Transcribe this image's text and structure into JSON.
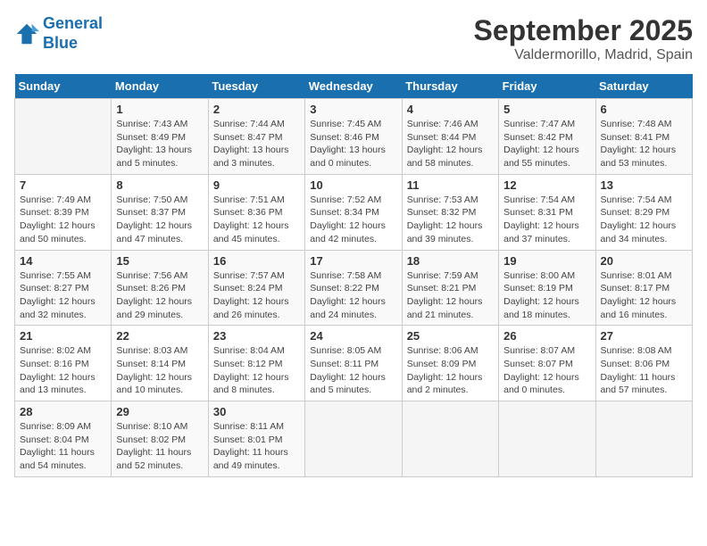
{
  "logo": {
    "line1": "General",
    "line2": "Blue"
  },
  "title": "September 2025",
  "location": "Valdermorillo, Madrid, Spain",
  "weekdays": [
    "Sunday",
    "Monday",
    "Tuesday",
    "Wednesday",
    "Thursday",
    "Friday",
    "Saturday"
  ],
  "weeks": [
    [
      {
        "day": "",
        "info": ""
      },
      {
        "day": "1",
        "info": "Sunrise: 7:43 AM\nSunset: 8:49 PM\nDaylight: 13 hours\nand 5 minutes."
      },
      {
        "day": "2",
        "info": "Sunrise: 7:44 AM\nSunset: 8:47 PM\nDaylight: 13 hours\nand 3 minutes."
      },
      {
        "day": "3",
        "info": "Sunrise: 7:45 AM\nSunset: 8:46 PM\nDaylight: 13 hours\nand 0 minutes."
      },
      {
        "day": "4",
        "info": "Sunrise: 7:46 AM\nSunset: 8:44 PM\nDaylight: 12 hours\nand 58 minutes."
      },
      {
        "day": "5",
        "info": "Sunrise: 7:47 AM\nSunset: 8:42 PM\nDaylight: 12 hours\nand 55 minutes."
      },
      {
        "day": "6",
        "info": "Sunrise: 7:48 AM\nSunset: 8:41 PM\nDaylight: 12 hours\nand 53 minutes."
      }
    ],
    [
      {
        "day": "7",
        "info": "Sunrise: 7:49 AM\nSunset: 8:39 PM\nDaylight: 12 hours\nand 50 minutes."
      },
      {
        "day": "8",
        "info": "Sunrise: 7:50 AM\nSunset: 8:37 PM\nDaylight: 12 hours\nand 47 minutes."
      },
      {
        "day": "9",
        "info": "Sunrise: 7:51 AM\nSunset: 8:36 PM\nDaylight: 12 hours\nand 45 minutes."
      },
      {
        "day": "10",
        "info": "Sunrise: 7:52 AM\nSunset: 8:34 PM\nDaylight: 12 hours\nand 42 minutes."
      },
      {
        "day": "11",
        "info": "Sunrise: 7:53 AM\nSunset: 8:32 PM\nDaylight: 12 hours\nand 39 minutes."
      },
      {
        "day": "12",
        "info": "Sunrise: 7:54 AM\nSunset: 8:31 PM\nDaylight: 12 hours\nand 37 minutes."
      },
      {
        "day": "13",
        "info": "Sunrise: 7:54 AM\nSunset: 8:29 PM\nDaylight: 12 hours\nand 34 minutes."
      }
    ],
    [
      {
        "day": "14",
        "info": "Sunrise: 7:55 AM\nSunset: 8:27 PM\nDaylight: 12 hours\nand 32 minutes."
      },
      {
        "day": "15",
        "info": "Sunrise: 7:56 AM\nSunset: 8:26 PM\nDaylight: 12 hours\nand 29 minutes."
      },
      {
        "day": "16",
        "info": "Sunrise: 7:57 AM\nSunset: 8:24 PM\nDaylight: 12 hours\nand 26 minutes."
      },
      {
        "day": "17",
        "info": "Sunrise: 7:58 AM\nSunset: 8:22 PM\nDaylight: 12 hours\nand 24 minutes."
      },
      {
        "day": "18",
        "info": "Sunrise: 7:59 AM\nSunset: 8:21 PM\nDaylight: 12 hours\nand 21 minutes."
      },
      {
        "day": "19",
        "info": "Sunrise: 8:00 AM\nSunset: 8:19 PM\nDaylight: 12 hours\nand 18 minutes."
      },
      {
        "day": "20",
        "info": "Sunrise: 8:01 AM\nSunset: 8:17 PM\nDaylight: 12 hours\nand 16 minutes."
      }
    ],
    [
      {
        "day": "21",
        "info": "Sunrise: 8:02 AM\nSunset: 8:16 PM\nDaylight: 12 hours\nand 13 minutes."
      },
      {
        "day": "22",
        "info": "Sunrise: 8:03 AM\nSunset: 8:14 PM\nDaylight: 12 hours\nand 10 minutes."
      },
      {
        "day": "23",
        "info": "Sunrise: 8:04 AM\nSunset: 8:12 PM\nDaylight: 12 hours\nand 8 minutes."
      },
      {
        "day": "24",
        "info": "Sunrise: 8:05 AM\nSunset: 8:11 PM\nDaylight: 12 hours\nand 5 minutes."
      },
      {
        "day": "25",
        "info": "Sunrise: 8:06 AM\nSunset: 8:09 PM\nDaylight: 12 hours\nand 2 minutes."
      },
      {
        "day": "26",
        "info": "Sunrise: 8:07 AM\nSunset: 8:07 PM\nDaylight: 12 hours\nand 0 minutes."
      },
      {
        "day": "27",
        "info": "Sunrise: 8:08 AM\nSunset: 8:06 PM\nDaylight: 11 hours\nand 57 minutes."
      }
    ],
    [
      {
        "day": "28",
        "info": "Sunrise: 8:09 AM\nSunset: 8:04 PM\nDaylight: 11 hours\nand 54 minutes."
      },
      {
        "day": "29",
        "info": "Sunrise: 8:10 AM\nSunset: 8:02 PM\nDaylight: 11 hours\nand 52 minutes."
      },
      {
        "day": "30",
        "info": "Sunrise: 8:11 AM\nSunset: 8:01 PM\nDaylight: 11 hours\nand 49 minutes."
      },
      {
        "day": "",
        "info": ""
      },
      {
        "day": "",
        "info": ""
      },
      {
        "day": "",
        "info": ""
      },
      {
        "day": "",
        "info": ""
      }
    ]
  ]
}
